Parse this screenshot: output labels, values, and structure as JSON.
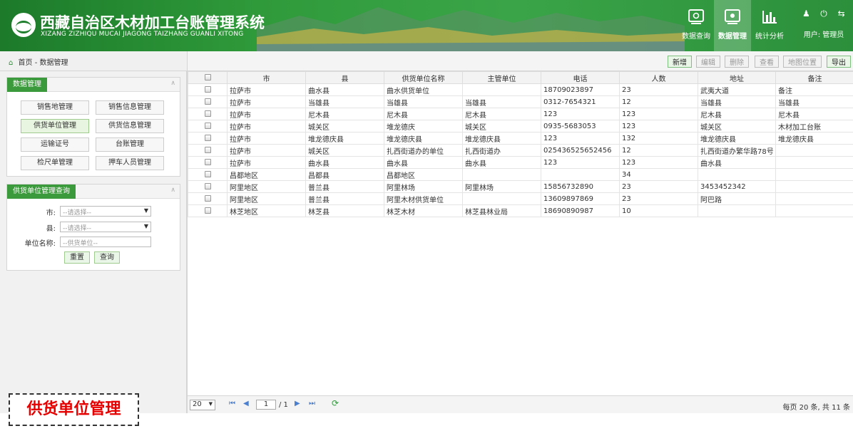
{
  "header": {
    "title": "西藏自治区木材加工台账管理系统",
    "subtitle": "XIZANG ZIZHIQU MUCAI JIAGONG TAIZHANG GUANLI XITONG",
    "nav": [
      "数据查询",
      "数据管理",
      "统计分析"
    ],
    "user_label": "用户: 管理员"
  },
  "breadcrumb": "首页 - 数据管理",
  "toolbar": {
    "add": "新增",
    "edit": "编辑",
    "delete": "删除",
    "view": "查看",
    "map": "地图位置",
    "export": "导出"
  },
  "sidebar": {
    "data_title": "数据管理",
    "menu": [
      "销售地管理",
      "销售信息管理",
      "供货单位管理",
      "供货信息管理",
      "运输证号",
      "台账管理",
      "检尺单管理",
      "押车人员管理"
    ],
    "query_title": "供货单位管理查询",
    "labels": {
      "city": "市:",
      "county": "县:",
      "unit": "单位名称:"
    },
    "placeholders": {
      "city": "--请选择--",
      "county": "--请选择--",
      "unit": "--供货单位--"
    },
    "reset": "重置",
    "search": "查询"
  },
  "table": {
    "columns": [
      "市",
      "县",
      "供货单位名称",
      "主管单位",
      "电话",
      "人数",
      "地址",
      "备注"
    ],
    "rows": [
      [
        "拉萨市",
        "曲水县",
        "曲水供货单位",
        "",
        "18709023897",
        "23",
        "武夷大道",
        "备注"
      ],
      [
        "拉萨市",
        "当雄县",
        "当雄县",
        "当雄县",
        "0312-7654321",
        "12",
        "当雄县",
        "当雄县"
      ],
      [
        "拉萨市",
        "尼木县",
        "尼木县",
        "尼木县",
        "123",
        "123",
        "尼木县",
        "尼木县"
      ],
      [
        "拉萨市",
        "城关区",
        "堆龙德庆",
        "城关区",
        "0935-5683053",
        "123",
        "城关区",
        "木材加工台账"
      ],
      [
        "拉萨市",
        "堆龙德庆县",
        "堆龙德庆县",
        "堆龙德庆县",
        "123",
        "132",
        "堆龙德庆县",
        "堆龙德庆县"
      ],
      [
        "拉萨市",
        "城关区",
        "扎西街道办的单位",
        "扎西街道办",
        "025436525652456",
        "12",
        "扎西街道办繁华路78号",
        ""
      ],
      [
        "拉萨市",
        "曲水县",
        "曲水县",
        "曲水县",
        "123",
        "123",
        "曲水县",
        ""
      ],
      [
        "昌都地区",
        "昌都县",
        "昌都地区",
        "",
        "",
        "34",
        "",
        ""
      ],
      [
        "阿里地区",
        "普兰县",
        "阿里林场",
        "阿里林场",
        "15856732890",
        "23",
        "3453452342",
        ""
      ],
      [
        "阿里地区",
        "普兰县",
        "阿里木材供货单位",
        "",
        "13609897869",
        "23",
        "阿巴路",
        ""
      ],
      [
        "林芝地区",
        "林芝县",
        "林芝木材",
        "林芝县林业局",
        "18690890987",
        "10",
        "",
        ""
      ]
    ]
  },
  "pager": {
    "page_size": "20",
    "page": "1",
    "total_pages": "/ 1",
    "info": "每页 20 条, 共 11 条"
  },
  "caption": "供货单位管理"
}
